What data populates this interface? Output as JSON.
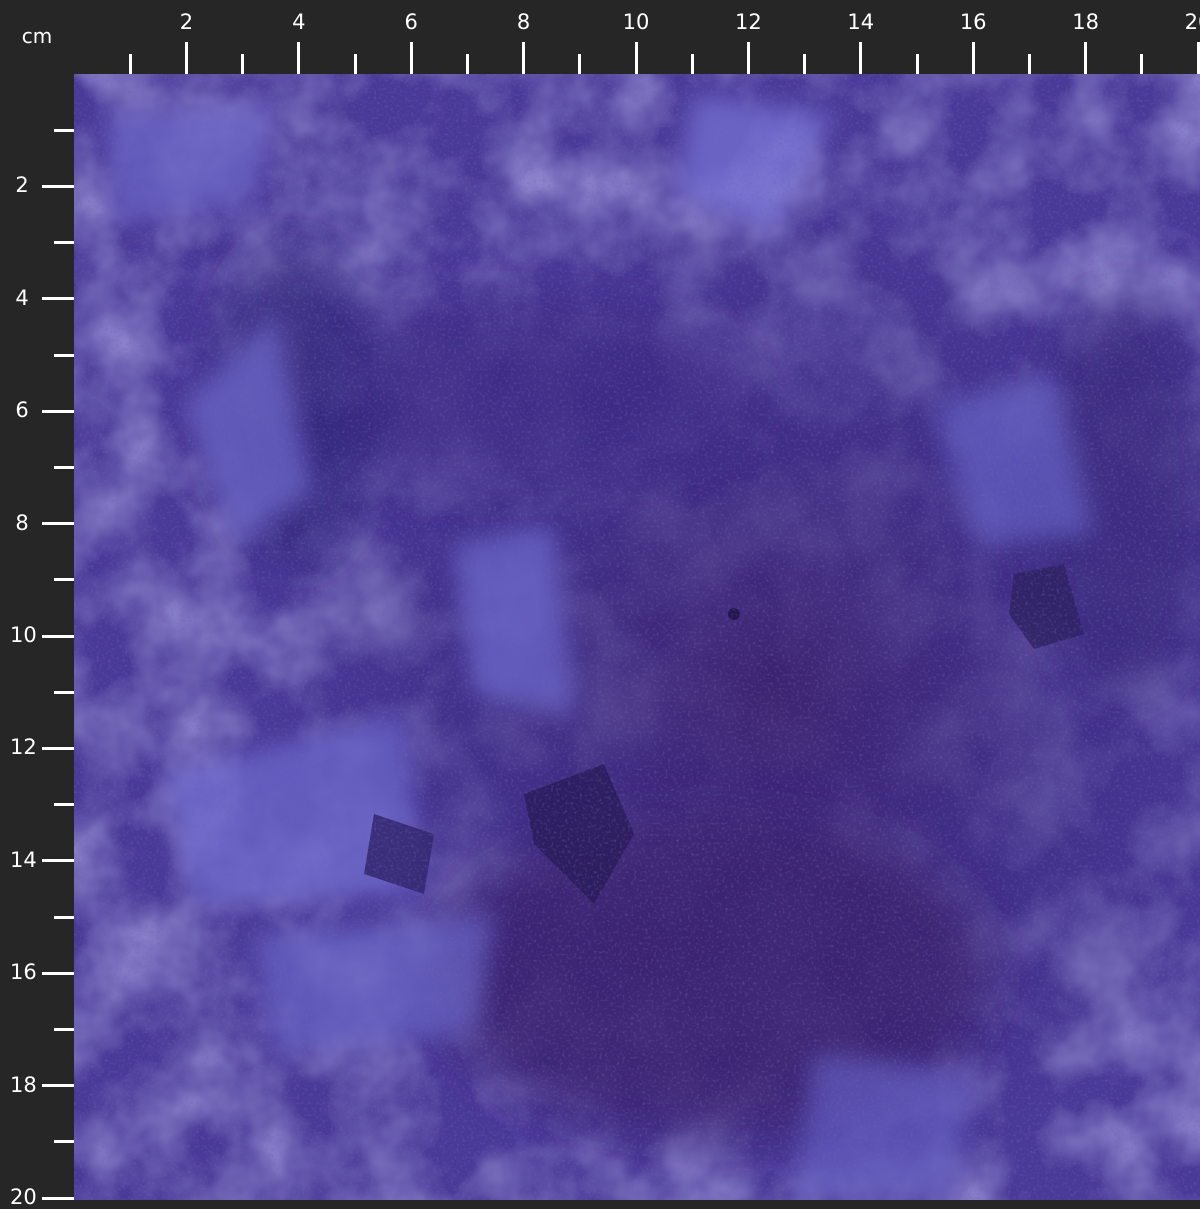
{
  "ruler": {
    "unit": "cm",
    "major_labels": [
      "2",
      "4",
      "6",
      "8",
      "10",
      "12",
      "14",
      "16",
      "18",
      "20"
    ],
    "tick_color": "#ffffff",
    "background_color": "#262626"
  },
  "fabric": {
    "description_colors": {
      "base": "#4a3a98",
      "light": "#6f6bd0",
      "dark": "#2b1f6a",
      "plum": "#4a2168"
    }
  }
}
